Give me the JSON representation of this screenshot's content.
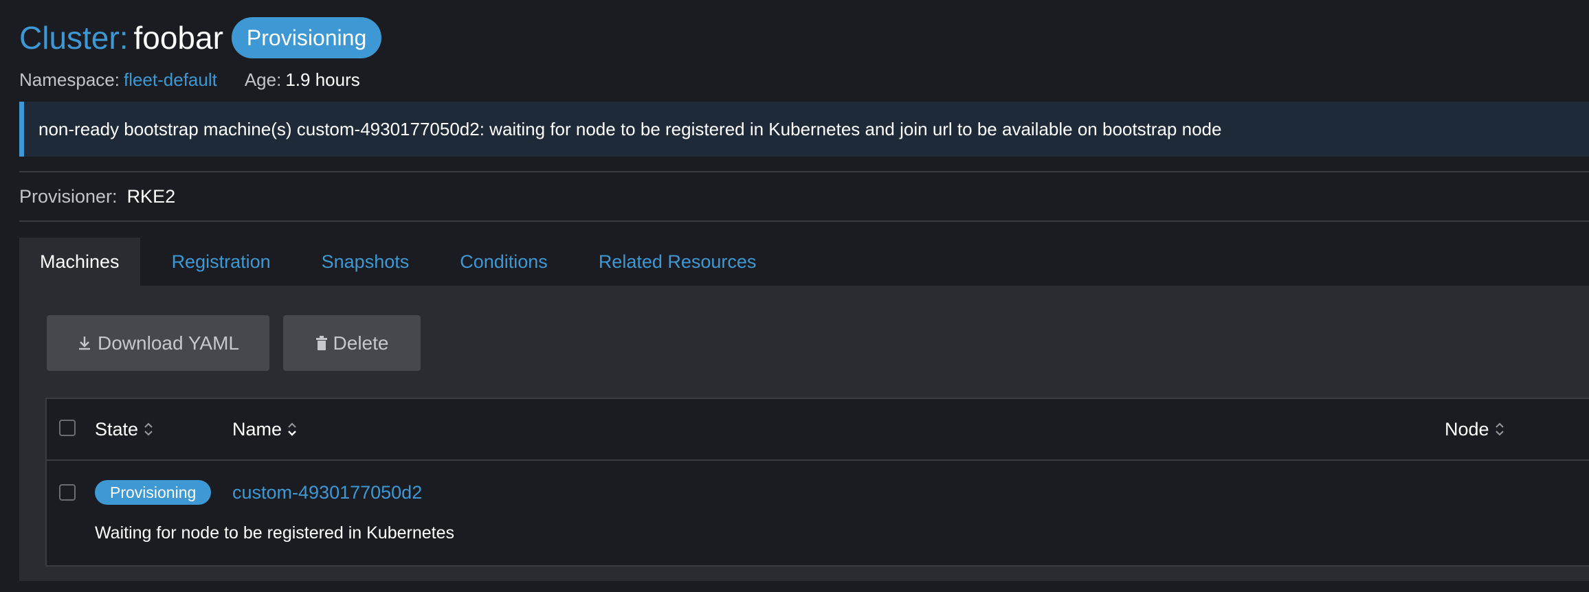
{
  "header": {
    "title_prefix": "Cluster:",
    "title_name": "foobar",
    "status_badge": "Provisioning",
    "namespace_label": "Namespace:",
    "namespace_value": "fleet-default",
    "age_label": "Age:",
    "age_value": "1.9 hours"
  },
  "banner": {
    "message": "non-ready bootstrap machine(s) custom-4930177050d2: waiting for node to be registered in Kubernetes and join url to be available on bootstrap node"
  },
  "provisioner": {
    "label": "Provisioner:",
    "value": "RKE2"
  },
  "tabs": [
    {
      "label": "Machines",
      "active": true
    },
    {
      "label": "Registration",
      "active": false
    },
    {
      "label": "Snapshots",
      "active": false
    },
    {
      "label": "Conditions",
      "active": false
    },
    {
      "label": "Related Resources",
      "active": false
    }
  ],
  "toolbar": {
    "download_label": "Download YAML",
    "delete_label": "Delete"
  },
  "table": {
    "columns": [
      "State",
      "Name",
      "Node"
    ],
    "rows": [
      {
        "state": "Provisioning",
        "name": "custom-4930177050d2",
        "node": "",
        "description": "Waiting for node to be registered in Kubernetes"
      }
    ]
  },
  "icons": {
    "download": "download-icon",
    "delete": "trash-icon",
    "sort": "sort-icon"
  },
  "colors": {
    "accent": "#3d98d3",
    "background": "#1b1c21",
    "panel": "#2b2c31",
    "banner": "#1e2a38"
  }
}
